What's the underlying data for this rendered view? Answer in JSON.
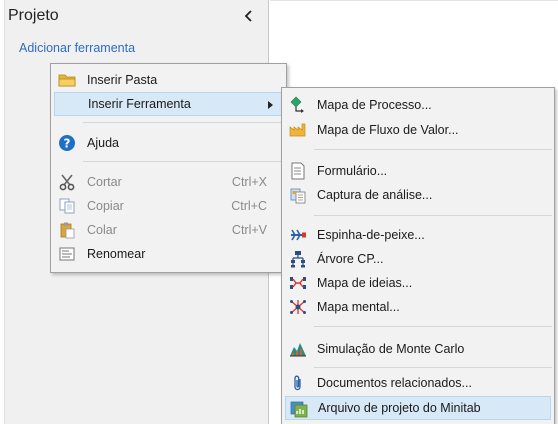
{
  "panel": {
    "title": "Projeto",
    "add_tool": "Adicionar ferramenta"
  },
  "menu": {
    "items": [
      {
        "label": "Inserir Pasta",
        "icon": "folder-icon"
      },
      {
        "label": "Inserir Ferramenta",
        "icon": "none",
        "submenu": true
      },
      {
        "label": "Ajuda",
        "icon": "help-icon"
      },
      {
        "label": "Cortar",
        "shortcut": "Ctrl+X",
        "icon": "scissors-icon",
        "disabled": true
      },
      {
        "label": "Copiar",
        "shortcut": "Ctrl+C",
        "icon": "copy-icon",
        "disabled": true
      },
      {
        "label": "Colar",
        "shortcut": "Ctrl+V",
        "icon": "paste-icon",
        "disabled": true
      },
      {
        "label": "Renomear",
        "icon": "rename-icon"
      }
    ]
  },
  "submenu": {
    "items": [
      {
        "label": "Mapa de Processo...",
        "icon": "process-map-icon"
      },
      {
        "label": "Mapa de Fluxo de Valor...",
        "icon": "value-stream-map-icon"
      },
      {
        "label": "Formulário...",
        "icon": "form-icon"
      },
      {
        "label": "Captura de análise...",
        "icon": "analysis-capture-icon"
      },
      {
        "label": "Espinha-de-peixe...",
        "icon": "fishbone-icon"
      },
      {
        "label": "Árvore CP...",
        "icon": "ct-tree-icon"
      },
      {
        "label": "Mapa de ideias...",
        "icon": "idea-map-icon"
      },
      {
        "label": "Mapa mental...",
        "icon": "mind-map-icon"
      },
      {
        "label": "Simulação de Monte Carlo",
        "icon": "monte-carlo-icon"
      },
      {
        "label": "Documentos relacionados...",
        "icon": "paperclip-icon"
      },
      {
        "label": "Arquivo de projeto do Minitab",
        "icon": "minitab-project-file-icon"
      }
    ]
  },
  "colors": {
    "link": "#2c6cc1",
    "highlight": "#d7e8f6",
    "panel_bg": "#f0f0f0",
    "menu_bg": "#f2f2f2"
  }
}
